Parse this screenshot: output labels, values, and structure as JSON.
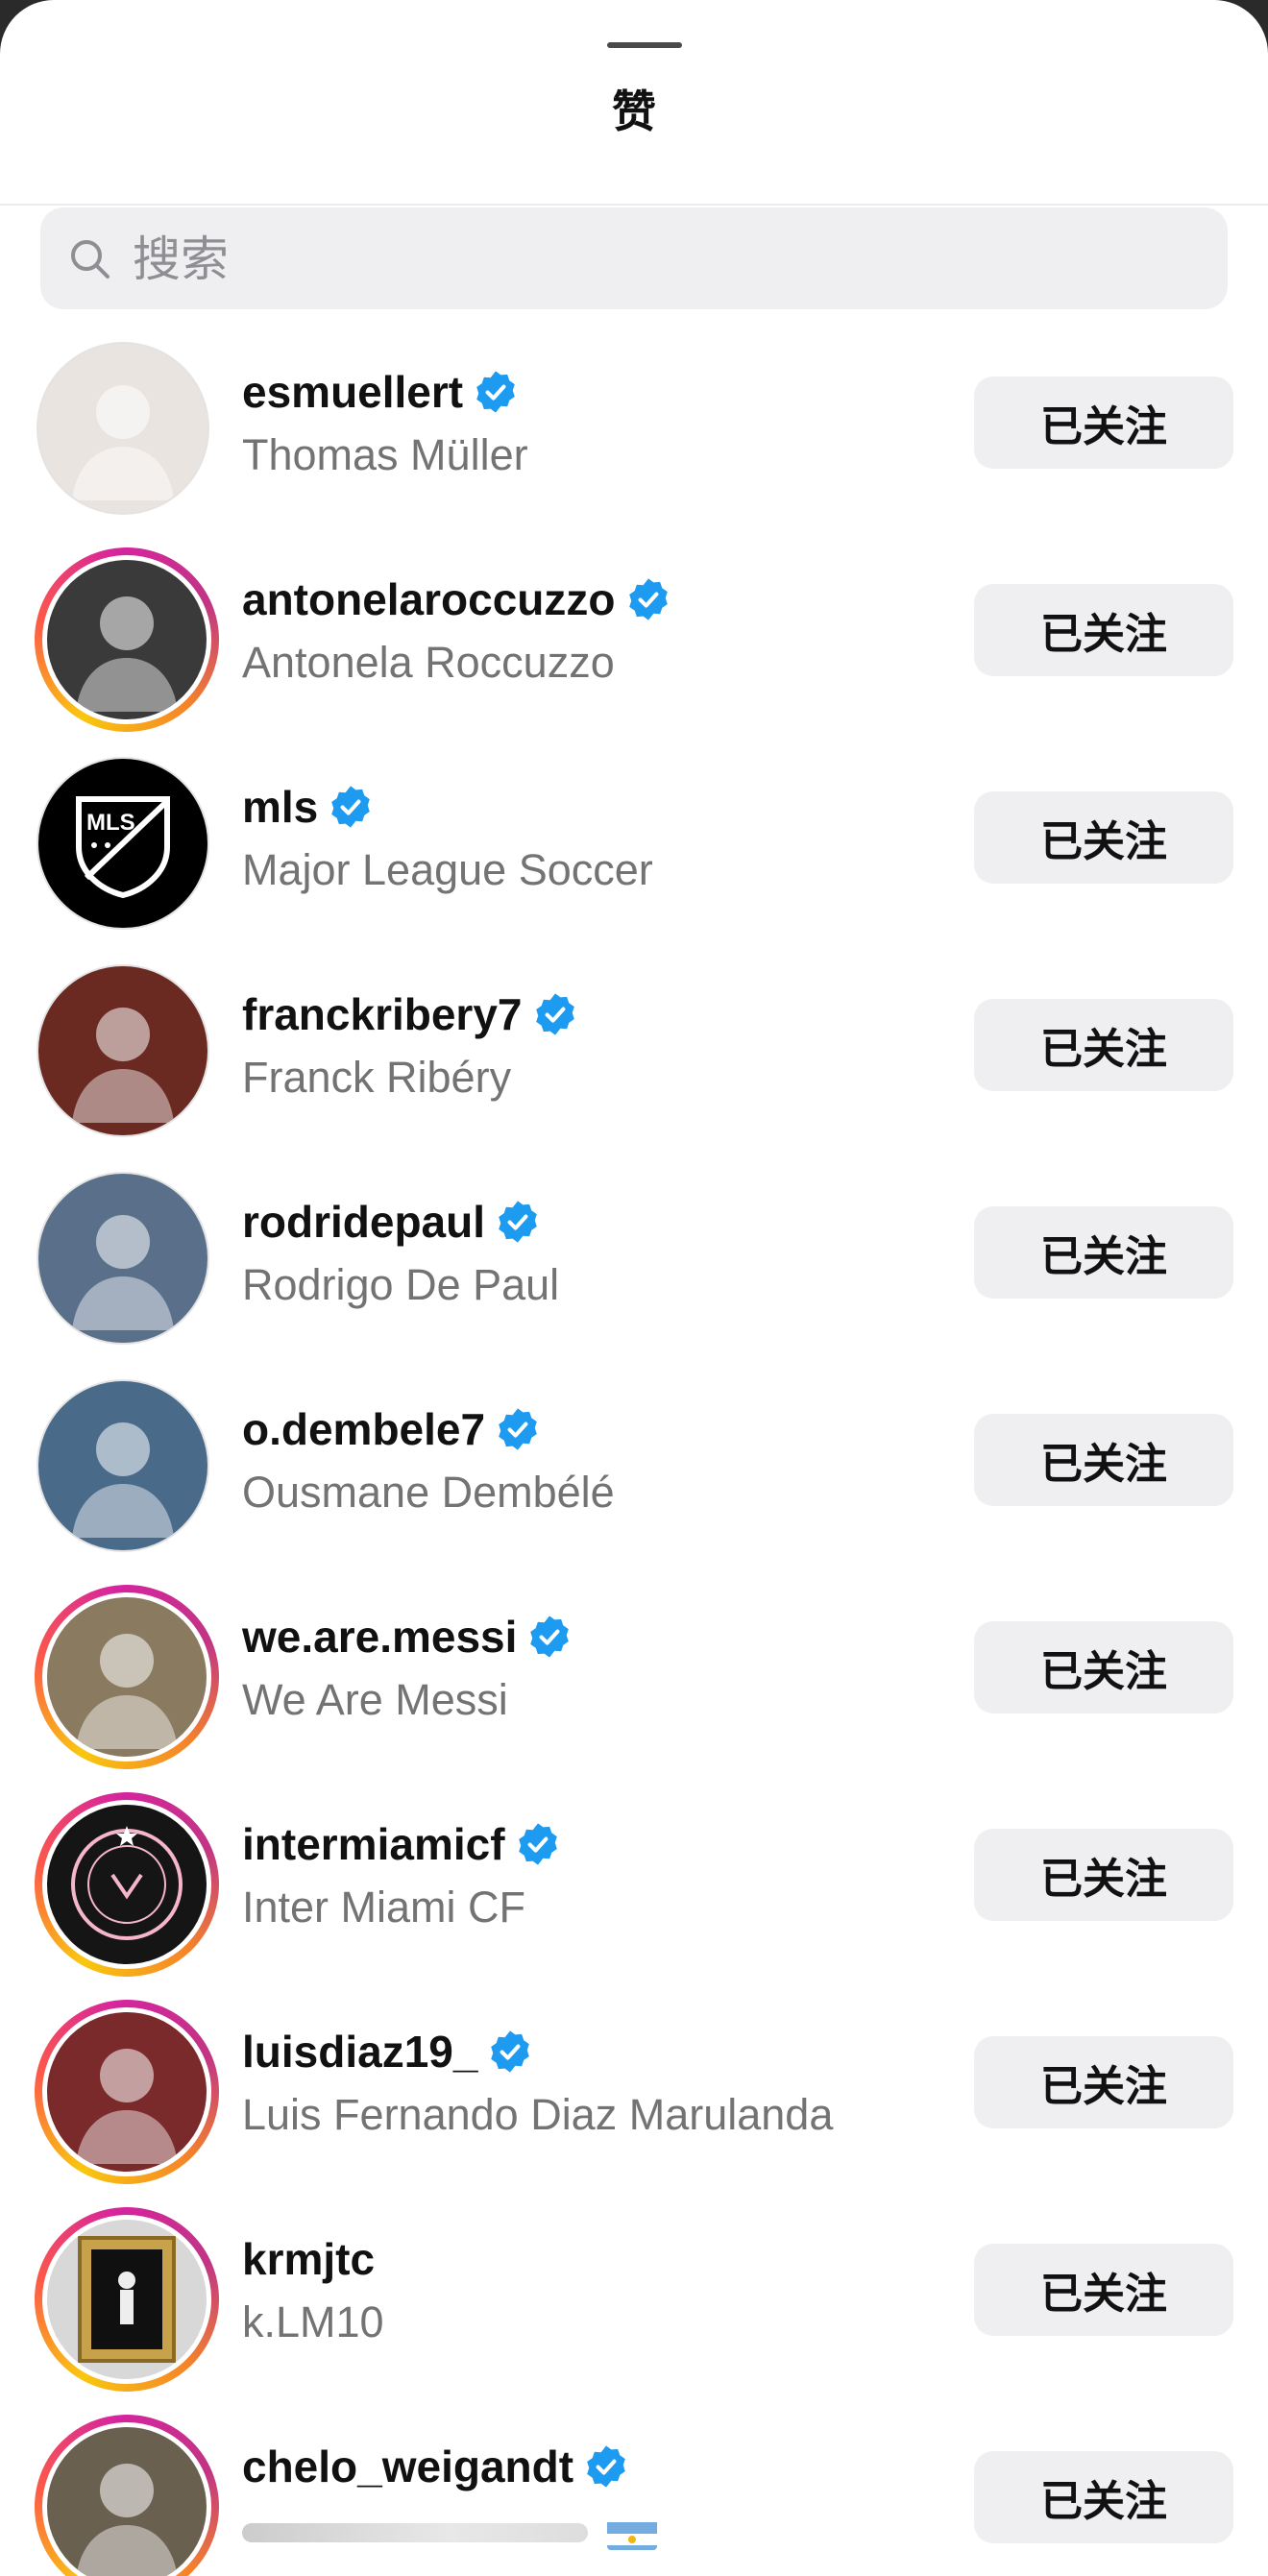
{
  "header": {
    "title": "赞"
  },
  "search": {
    "placeholder": "搜索"
  },
  "colors": {
    "verified": "#1d9bf0",
    "button_bg": "#efeff1",
    "story_ring": "#d6249f"
  },
  "users": [
    {
      "username": "esmuellert",
      "full_name": "Thomas Müller",
      "verified": true,
      "story_ring": false,
      "button": "已关注",
      "avatar_icon": "person-icon"
    },
    {
      "username": "antonelaroccuzzo",
      "full_name": "Antonela Roccuzzo",
      "verified": true,
      "story_ring": true,
      "button": "已关注",
      "avatar_icon": "person-icon"
    },
    {
      "username": "mls",
      "full_name": "Major League Soccer",
      "verified": true,
      "story_ring": false,
      "button": "已关注",
      "avatar_icon": "mls-logo-icon",
      "logo_text": "MLS"
    },
    {
      "username": "franckribery7",
      "full_name": "Franck Ribéry",
      "verified": true,
      "story_ring": false,
      "button": "已关注",
      "avatar_icon": "person-icon"
    },
    {
      "username": "rodridepaul",
      "full_name": "Rodrigo De Paul",
      "verified": true,
      "story_ring": false,
      "button": "已关注",
      "avatar_icon": "person-icon"
    },
    {
      "username": "o.dembele7",
      "full_name": "Ousmane Dembélé",
      "verified": true,
      "story_ring": false,
      "button": "已关注",
      "avatar_icon": "person-icon"
    },
    {
      "username": "we.are.messi",
      "full_name": "We Are Messi",
      "verified": true,
      "story_ring": true,
      "button": "已关注",
      "avatar_icon": "person-icon"
    },
    {
      "username": "intermiamicf",
      "full_name": "Inter Miami CF",
      "verified": true,
      "story_ring": true,
      "button": "已关注",
      "avatar_icon": "inter-miami-crest-icon"
    },
    {
      "username": "luisdiaz19_",
      "full_name": "Luis Fernando Diaz Marulanda",
      "verified": true,
      "story_ring": true,
      "button": "已关注",
      "avatar_icon": "person-icon"
    },
    {
      "username": "krmjtc",
      "full_name": "k.LM10",
      "verified": false,
      "story_ring": true,
      "button": "已关注",
      "avatar_icon": "framed-picture-icon"
    },
    {
      "username": "chelo_weigandt",
      "full_name": "",
      "verified": true,
      "story_ring": true,
      "button": "已关注",
      "avatar_icon": "person-icon",
      "suffix_icon": "argentina-flag-icon"
    }
  ]
}
